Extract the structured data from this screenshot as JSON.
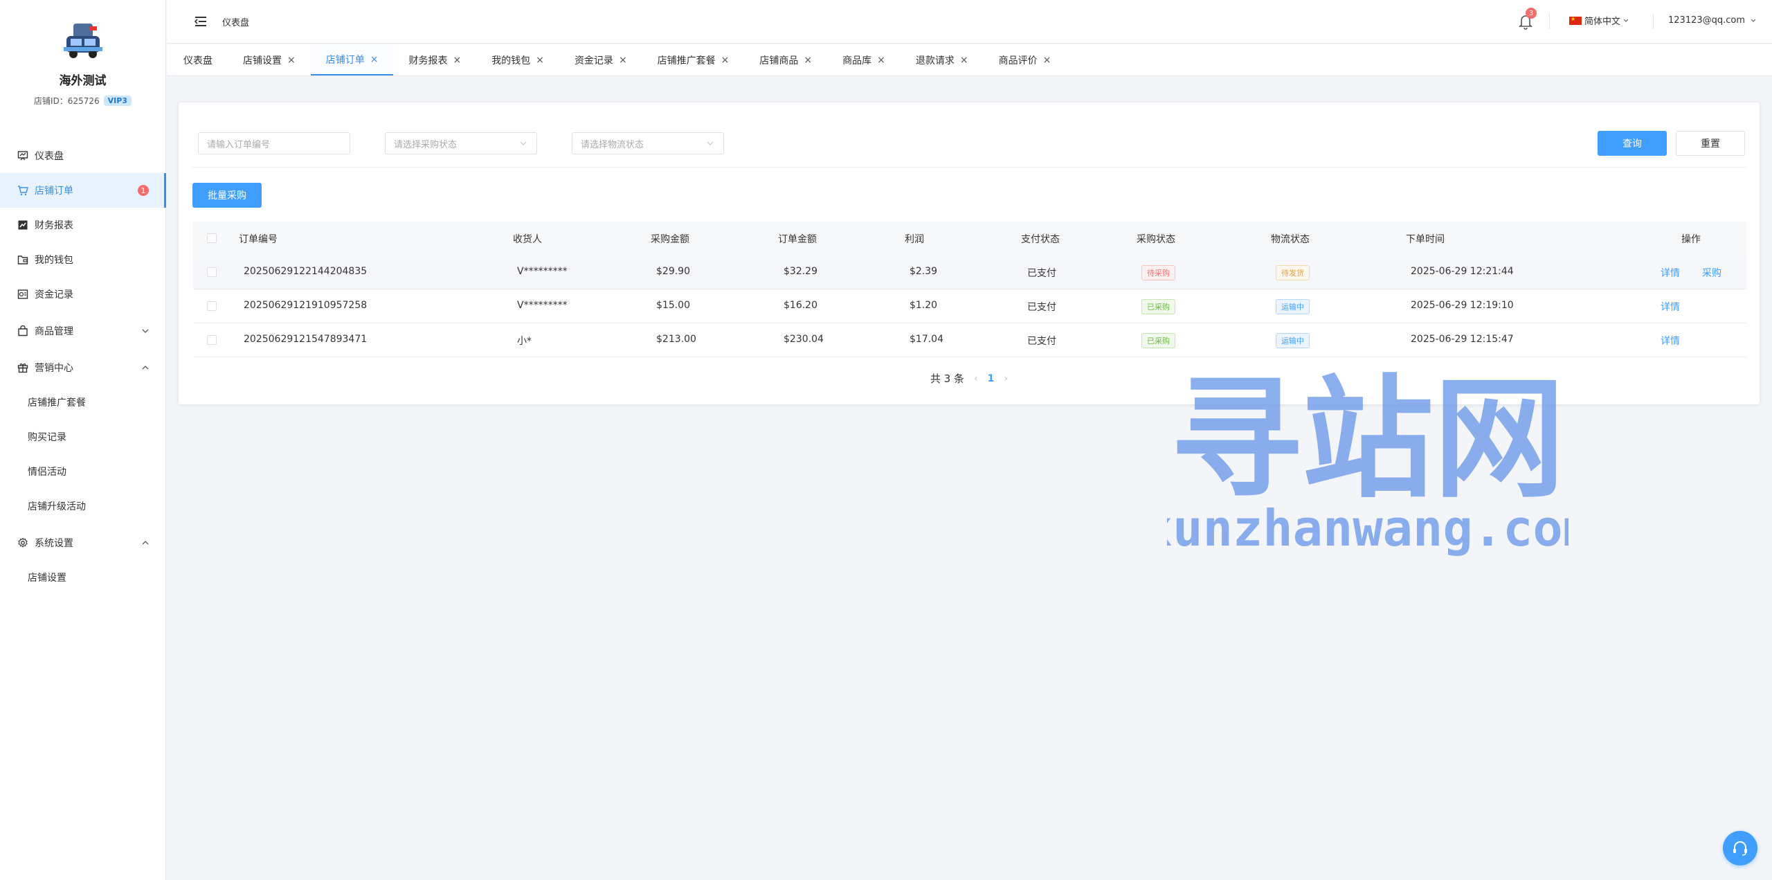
{
  "colors": {
    "accent": "#409eff",
    "danger": "#f56c6c"
  },
  "shop": {
    "name": "海外测试",
    "id_label": "店铺ID：625726",
    "vip": "VIP3"
  },
  "sidebar": {
    "items": [
      {
        "label": "仪表盘",
        "icon": "dashboard-icon"
      },
      {
        "label": "店铺订单",
        "icon": "cart-icon",
        "badge": "1"
      },
      {
        "label": "财务报表",
        "icon": "chart-icon"
      },
      {
        "label": "我的钱包",
        "icon": "wallet-icon"
      },
      {
        "label": "资金记录",
        "icon": "ledger-icon"
      },
      {
        "label": "商品管理",
        "icon": "bag-icon"
      },
      {
        "label": "营销中心",
        "icon": "gift-icon"
      },
      {
        "label": "系统设置",
        "icon": "gear-icon"
      }
    ],
    "marketing_sub": [
      "店铺推广套餐",
      "购买记录",
      "情侣活动",
      "店铺升级活动"
    ],
    "system_sub": [
      "店铺设置"
    ]
  },
  "header": {
    "breadcrumb": "仪表盘",
    "notifications": "3",
    "language": "简体中文",
    "user": "123123@qq.com"
  },
  "tabs": [
    {
      "label": "仪表盘",
      "closable": false
    },
    {
      "label": "店铺设置",
      "closable": true
    },
    {
      "label": "店铺订单",
      "closable": true,
      "active": true
    },
    {
      "label": "财务报表",
      "closable": true
    },
    {
      "label": "我的钱包",
      "closable": true
    },
    {
      "label": "资金记录",
      "closable": true
    },
    {
      "label": "店铺推广套餐",
      "closable": true
    },
    {
      "label": "店铺商品",
      "closable": true
    },
    {
      "label": "商品库",
      "closable": true
    },
    {
      "label": "退款请求",
      "closable": true
    },
    {
      "label": "商品评价",
      "closable": true
    }
  ],
  "filters": {
    "order_no_placeholder": "请输入订单编号",
    "purchase_status_placeholder": "请选择采购状态",
    "logistics_status_placeholder": "请选择物流状态",
    "query": "查询",
    "reset": "重置",
    "batch_purchase": "批量采购"
  },
  "table": {
    "headers": [
      "订单编号",
      "收货人",
      "采购金额",
      "订单金额",
      "利润",
      "支付状态",
      "采购状态",
      "物流状态",
      "下单时间",
      "操作"
    ],
    "rows": [
      {
        "order_no": "20250629122144204835",
        "receiver": "V*********",
        "purchase_amount": "$29.90",
        "order_amount": "$32.29",
        "profit": "$2.39",
        "pay_status": "已支付",
        "purchase_status": "待采购",
        "logistics_status": "待发货",
        "time": "2025-06-29 12:21:44",
        "action_detail": "详情",
        "action_purchase": "采购"
      },
      {
        "order_no": "20250629121910957258",
        "receiver": "V*********",
        "purchase_amount": "$15.00",
        "order_amount": "$16.20",
        "profit": "$1.20",
        "pay_status": "已支付",
        "purchase_status": "已采购",
        "logistics_status": "运输中",
        "time": "2025-06-29 12:19:10",
        "action_detail": "详情"
      },
      {
        "order_no": "20250629121547893471",
        "receiver": "小*",
        "purchase_amount": "$213.00",
        "order_amount": "$230.04",
        "profit": "$17.04",
        "pay_status": "已支付",
        "purchase_status": "已采购",
        "logistics_status": "运输中",
        "time": "2025-06-29 12:15:47",
        "action_detail": "详情"
      }
    ]
  },
  "pagination": {
    "total": "共 3 条",
    "current": "1"
  },
  "watermark": {
    "title": "寻站网",
    "url": "xunzhanwang.com"
  }
}
